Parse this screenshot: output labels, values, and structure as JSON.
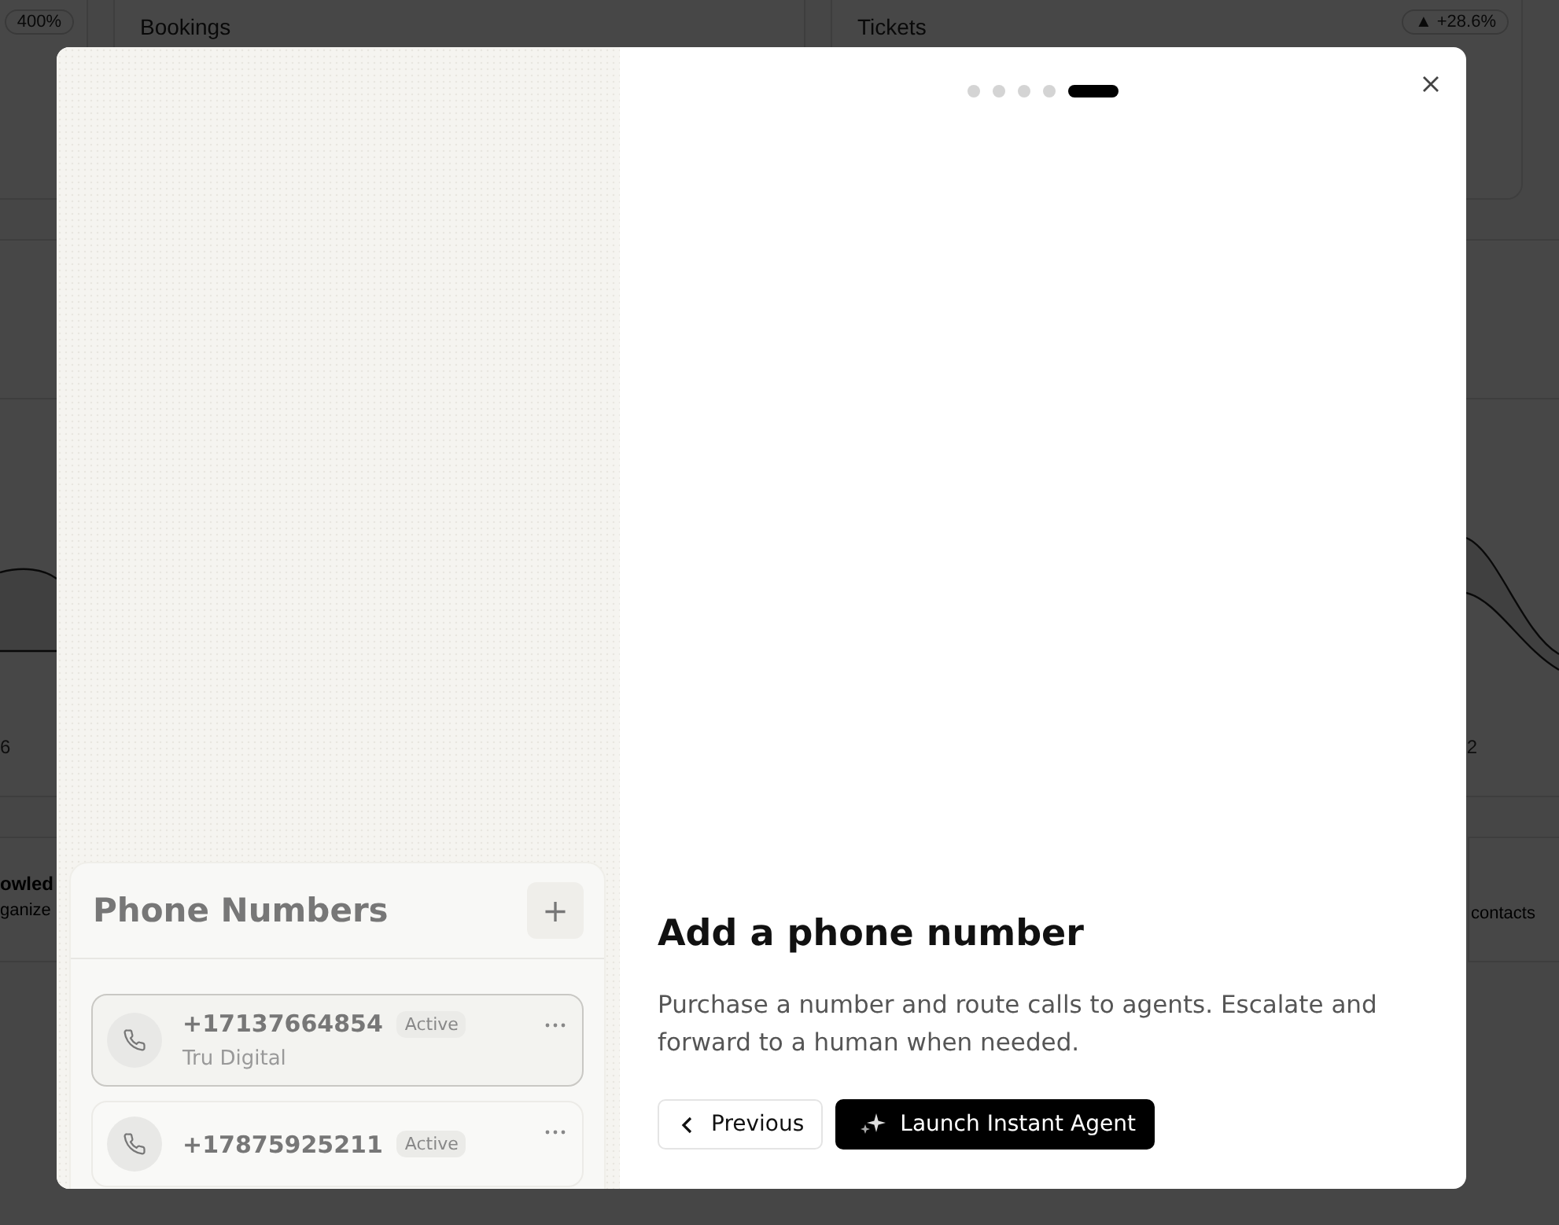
{
  "dashboard": {
    "stat_cards": [
      {
        "badge": "400%"
      },
      {
        "title": "Bookings"
      },
      {
        "title": "Tickets",
        "badge": "+28.6%",
        "trend_icon": "▲"
      }
    ],
    "chart": {
      "axis_labels": [
        "6",
        "2"
      ]
    },
    "bottom_cards": [
      {
        "title": "owled",
        "subtitle": "ganize"
      },
      {
        "subtitle": "contacts"
      }
    ]
  },
  "modal": {
    "steps": [
      {
        "selected": false
      },
      {
        "selected": false
      },
      {
        "selected": false
      },
      {
        "selected": false
      },
      {
        "selected": true
      }
    ],
    "preview": {
      "title": "Phone Numbers",
      "add_label": "+",
      "numbers": [
        {
          "number": "+17137664854",
          "status": "Active",
          "carrier": "Tru Digital",
          "selected": true
        },
        {
          "number": "+17875925211",
          "status": "Active",
          "selected": false
        }
      ]
    },
    "title": "Add a phone number",
    "description": "Purchase a number and route calls to agents. Escalate and forward to a human when needed.",
    "buttons": [
      {
        "kind": "secondary",
        "label": "Previous"
      },
      {
        "kind": "primary",
        "label": "Launch Instant Agent"
      }
    ]
  }
}
